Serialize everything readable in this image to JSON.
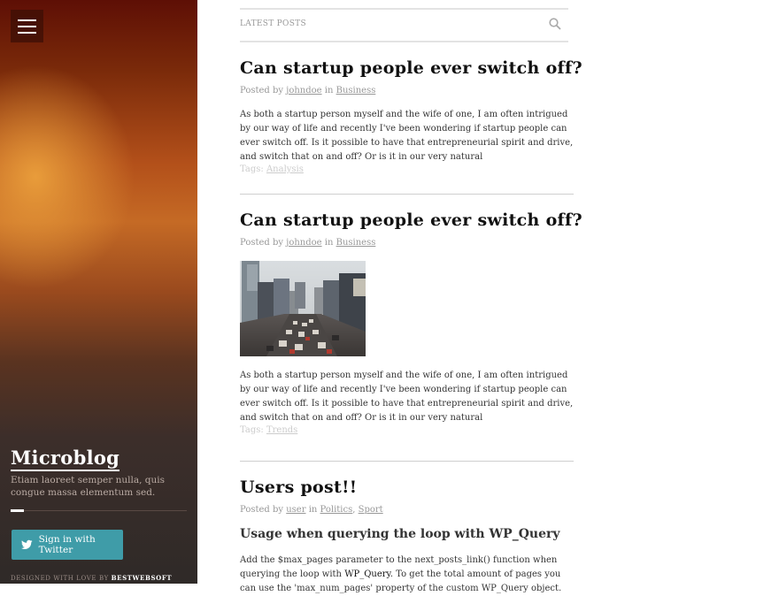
{
  "sidebar": {
    "menu_icon": "hamburger-icon",
    "title": "Microblog",
    "description": "Etiam laoreet semper nulla, quis congue massa elementum sed.",
    "twitter_button": "Sign in with Twitter",
    "twitter_icon": "twitter-bird-icon",
    "credit_prefix": "DESIGNED WITH LOVE BY",
    "credit_brand": "BESTWEBSOFT"
  },
  "topbar": {
    "label": "LATEST POSTS",
    "search_icon": "search-icon"
  },
  "posts": [
    {
      "title": "Can startup people ever switch off?",
      "posted_by": "Posted by",
      "author": "johndoe",
      "in": "in",
      "categories": [
        "Business"
      ],
      "excerpt": "As both a startup person myself and the wife of one, I am often intrigued by our way of life and recently I've been wondering if startup people can ever switch off. Is it possible to have that entrepreneurial spirit and drive, and switch that on and off? Or is it in our very natural",
      "tags_label": "Tags:",
      "tags": [
        "Analysis"
      ]
    },
    {
      "title": "Can startup people ever switch off?",
      "posted_by": "Posted by",
      "author": "johndoe",
      "in": "in",
      "categories": [
        "Business"
      ],
      "image": "city-traffic-photo",
      "excerpt": "As both a startup person myself and the wife of one, I am often intrigued by our way of life and recently I've been wondering if startup people can ever switch off. Is it possible to have that entrepreneurial spirit and drive, and switch that on and off? Or is it in our very natural",
      "tags_label": "Tags:",
      "tags": [
        "Trends"
      ]
    },
    {
      "title": "Users post!!",
      "posted_by": "Posted by",
      "author": "user",
      "in": "in",
      "categories": [
        "Politics",
        "Sport"
      ],
      "category_sep": ",",
      "subheading": "Usage when querying the loop with WP_Query",
      "excerpt_part1": "Add the $max_pages parameter to the next_posts_link() function when querying the loop with ",
      "excerpt_code": "WP_Query",
      "excerpt_part2": ". To get the total amount of pages you can use the 'max_num_pages' property of the custom WP_Query object."
    }
  ]
}
